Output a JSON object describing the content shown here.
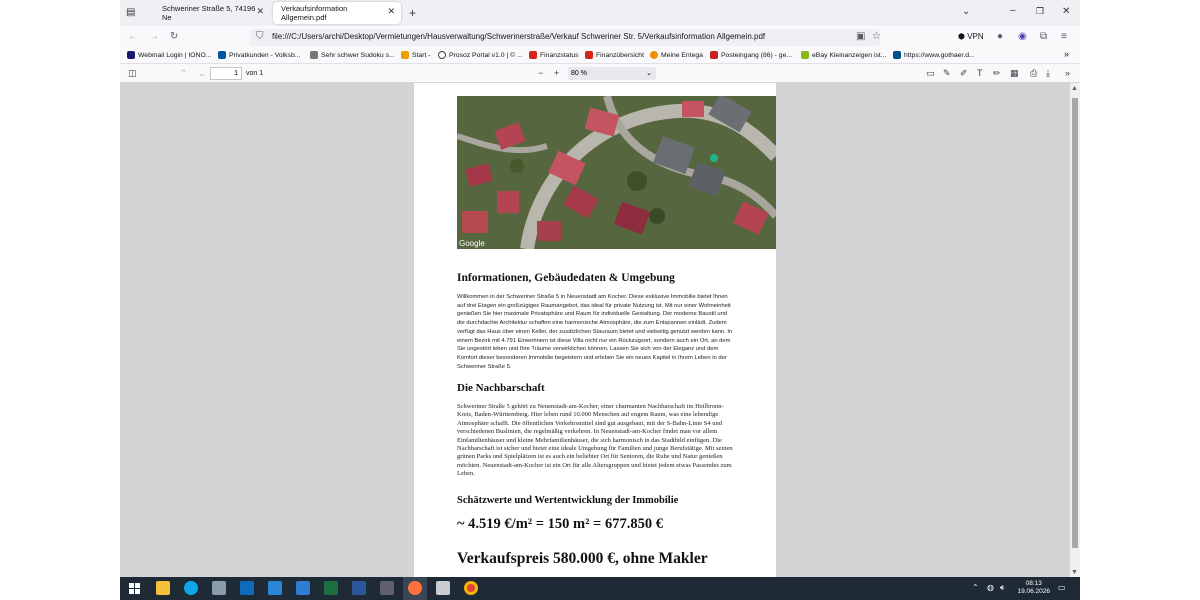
{
  "browser": {
    "tabs": [
      {
        "label": "Schweriner Straße 5, 74196 Ne",
        "active": false
      },
      {
        "label": "Verkaufsinformation Allgemein.pdf",
        "active": true
      }
    ],
    "url": "file:///C:/Users/archi/Desktop/Vermietungen/Hausverwaltung/Schwerinerstraße/Verkauf Schweriner Str. 5/Verkaufsinformation Allgemein.pdf",
    "vpn_label": "VPN",
    "bookmarks": [
      {
        "label": "Webmail Login | IONO...",
        "color": "#1a1a6e"
      },
      {
        "label": "Privatkunden - Volksb...",
        "color": "#0055a5"
      },
      {
        "label": "Sehr schwer Sudoku s...",
        "color": "#777777"
      },
      {
        "label": "Start -",
        "color": "#e8a000"
      },
      {
        "label": "Prosoz Portal v1.0 | © ...",
        "color": "#444444"
      },
      {
        "label": "Finanzstatus",
        "color": "#d4261b"
      },
      {
        "label": "Finanzübersicht",
        "color": "#d4261b"
      },
      {
        "label": "Meine Entega",
        "color": "#f29000"
      },
      {
        "label": "Posteingang (86) - ge...",
        "color": "#c5221f"
      },
      {
        "label": "eBay Kleinanzeigen ist...",
        "color": "#86b817"
      },
      {
        "label": "https://www.gothaer.d...",
        "color": "#00508c"
      }
    ]
  },
  "pdf_toolbar": {
    "page_number": "1",
    "page_of": "von 1",
    "zoom": "80 %"
  },
  "document": {
    "map_label": "Google",
    "section1_title": "Informationen, Gebäudedaten & Umgebung",
    "section1_text": "Willkommen in der Schweriner Straße 5 in Neuenstadt am Kocher. Diese exklusive Immobilie bietet Ihnen auf drei Etagen ein großzügiges Raumangebot, das ideal für private Nutzung ist. Mit nur einer Wohneinheit genießen Sie hier maximale Privatsphäre und Raum für individuelle Gestaltung. Der moderne Baustil und die durchdachte Architektur schaffen eine harmonische Atmosphäre, die zum Entspannen einlädt. Zudem verfügt das Haus über einen Keller, der zusätzlichen Stauraum bietet und vielseitig genutzt werden kann. In einem Bezirk mit 4.791 Einwohnern ist diese Villa nicht nur ein Rückzugsort, sondern auch ein Ort, an dem Sie ungestört leben und Ihre Träume verwirklichen können. Lassen Sie sich von der Eleganz und dem Komfort dieser besonderen Immobilie begeistern und erleben Sie ein neues Kapitel in Ihrem Leben in der Schweriner Straße 5.",
    "section2_title": "Die Nachbarschaft",
    "section2_text": "Schweriner Straße 5 gehört zu Neuenstadt-am-Kocher, einer charmanten Nachbarschaft im Heilbronn-Kreis, Baden-Württemberg. Hier leben rund 10.000 Menschen auf engem Raum, was eine lebendige Atmosphäre schafft. Die öffentlichen Verkehrsmittel sind gut ausgebaut, mit der S-Bahn-Linie S4 und verschiedenen Buslinien, die regelmäßig verkehren. In Neuenstadt-am-Kocher findet man vor allem Einfamilienhäuser und kleine Mehrfamilienhäuser, die sich harmonisch in das Stadtbild einfügen. Die Nachbarschaft ist sicher und bietet eine ideale Umgebung für Familien und junge Berufstätige. Mit seinen grünen Parks und Spielplätzen ist es auch ein beliebter Ort für Senioren, die Ruhe und Natur genießen möchten. Neuenstadt-am-Kocher ist ein Ort für alle Altersgruppen und bietet jedem etwas Passendes zum Leben.",
    "section3_title": "Schätzwerte und Wertentwicklung der Immobilie",
    "calc_line": "~ 4.519 €/m²  = 150 m²  =  677.850 €",
    "price_line": "Verkaufspreis 580.000 €, ohne Makler"
  },
  "taskbar": {
    "time": "08:13",
    "date": "19.06.2026"
  }
}
